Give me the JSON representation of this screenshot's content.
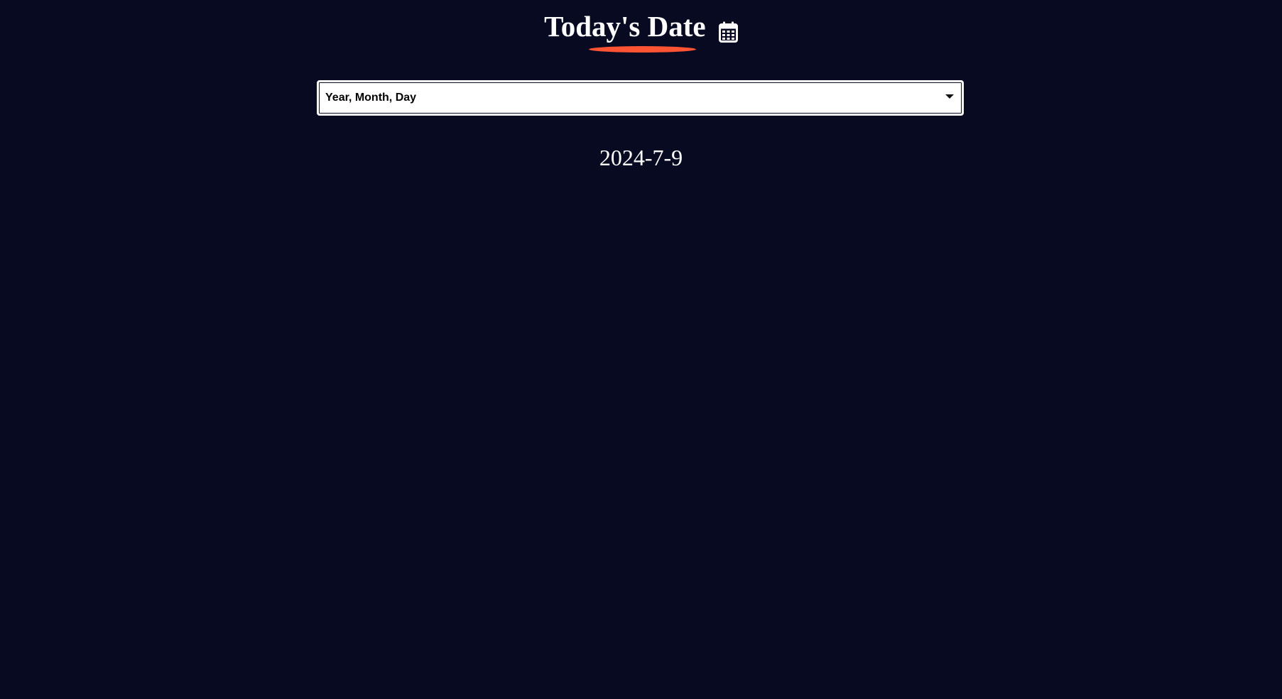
{
  "header": {
    "title": "Today's Date",
    "icon": "calendar-icon"
  },
  "colors": {
    "background": "#080a22",
    "accent": "#ff5433",
    "text": "#ffffff"
  },
  "format_select": {
    "selected": "Year, Month, Day"
  },
  "result": {
    "date": "2024-7-9"
  }
}
